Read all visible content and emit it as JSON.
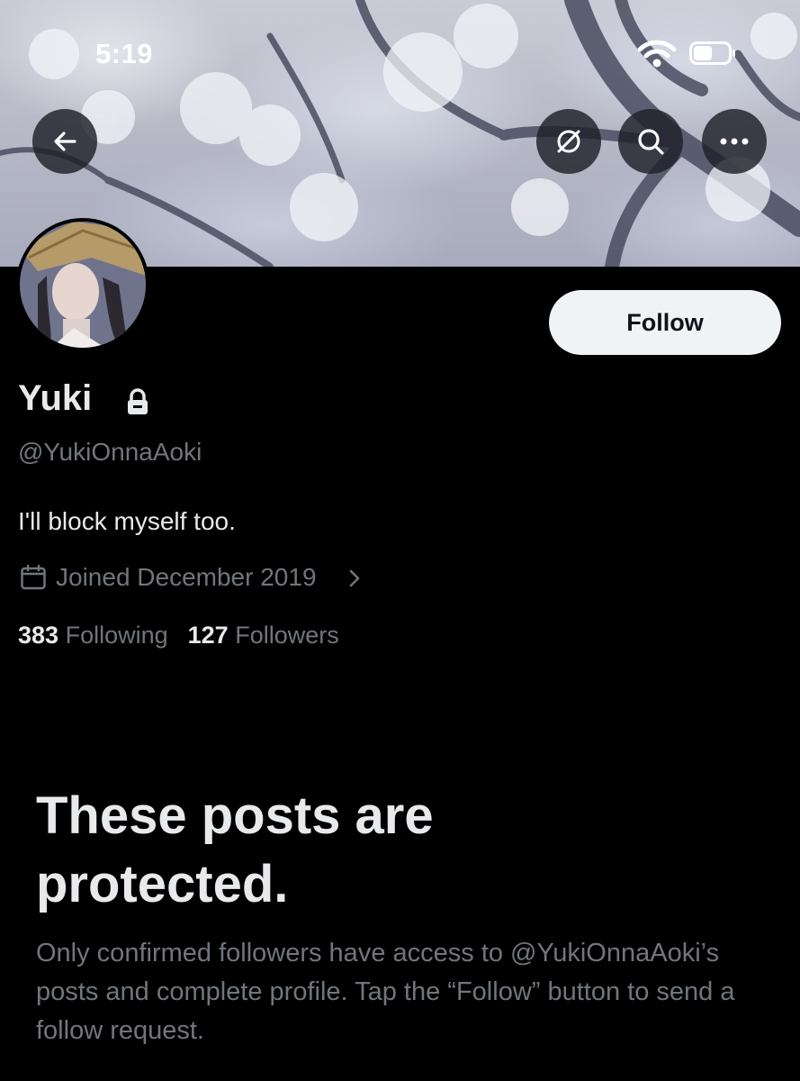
{
  "status_bar": {
    "time": "5:19"
  },
  "nav": {
    "back_icon": "arrow-left-icon",
    "mute_icon": "slashed-circle-icon",
    "search_icon": "search-icon",
    "more_icon": "more-dots-icon"
  },
  "profile": {
    "display_name": "Yuki",
    "handle": "@YukiOnnaAoki",
    "bio": "I'll block myself too.",
    "joined": "Joined December 2019",
    "following_count": "383",
    "following_label": "Following",
    "followers_count": "127",
    "followers_label": "Followers"
  },
  "follow_button": {
    "label": "Follow"
  },
  "protected_notice": {
    "title": "These posts are protected.",
    "description": "Only confirmed followers have access to @YukiOnnaAoki’s posts and complete profile. Tap the “Follow” button to send a follow request."
  },
  "colors": {
    "background": "#000000",
    "text_primary": "#e7e9ea",
    "text_secondary": "#71767b",
    "button_bg": "#eff3f4"
  }
}
